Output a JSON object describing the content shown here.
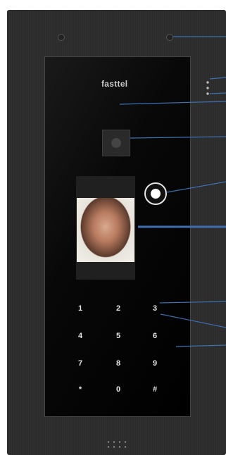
{
  "device": {
    "brand": "fasttel",
    "keypad": [
      "1",
      "2",
      "3",
      "4",
      "5",
      "6",
      "7",
      "8",
      "9",
      "*",
      "0",
      "#"
    ]
  },
  "colors": {
    "panel": "#2e2e2e",
    "glass": "#050505",
    "callout_line": "#3f6fb0",
    "key_text": "#e6e6e6"
  }
}
